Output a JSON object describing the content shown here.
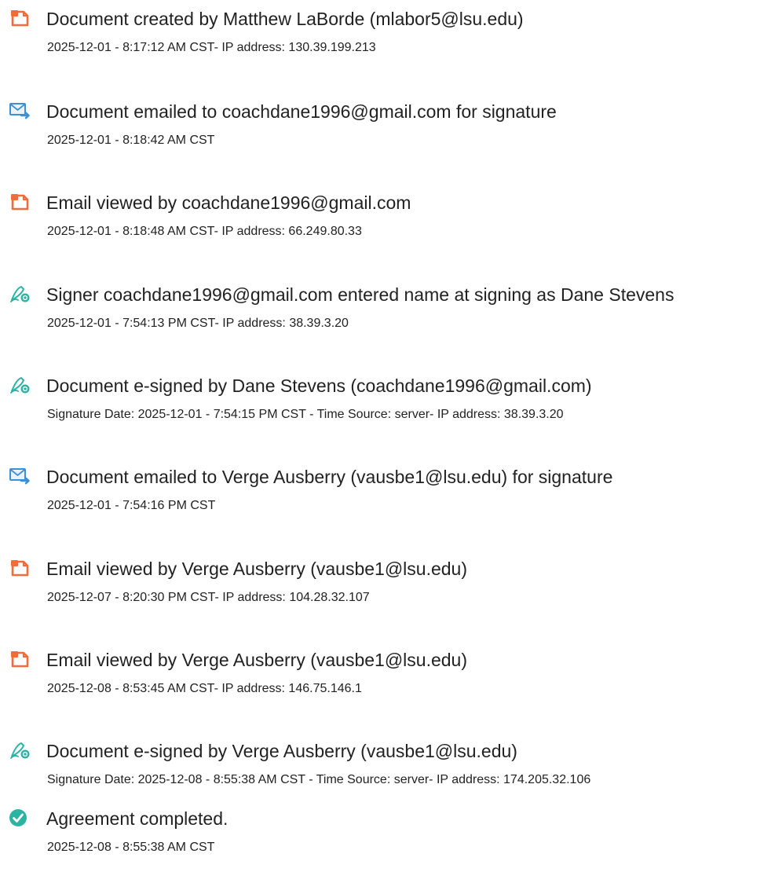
{
  "events": [
    {
      "icon": "document-icon",
      "title": "Document created by Matthew LaBorde (mlabor5@lsu.edu)",
      "detail": "2025-12-01 - 8:17:12 AM CST- IP address: 130.39.199.213"
    },
    {
      "icon": "email-sent-icon",
      "title": "Document emailed to coachdane1996@gmail.com for signature",
      "detail": "2025-12-01 - 8:18:42 AM CST"
    },
    {
      "icon": "document-icon",
      "title": "Email viewed by coachdane1996@gmail.com",
      "detail": "2025-12-01 - 8:18:48 AM CST- IP address: 66.249.80.33"
    },
    {
      "icon": "signature-pen-icon",
      "title": "Signer coachdane1996@gmail.com entered name at signing as Dane Stevens",
      "detail": "2025-12-01 - 7:54:13 PM CST- IP address: 38.39.3.20"
    },
    {
      "icon": "signature-pen-icon",
      "title": "Document e-signed by Dane Stevens (coachdane1996@gmail.com)",
      "detail": "Signature Date: 2025-12-01 - 7:54:15 PM CST - Time Source: server- IP address: 38.39.3.20"
    },
    {
      "icon": "email-sent-icon",
      "title": "Document emailed to Verge Ausberry (vausbe1@lsu.edu) for signature",
      "detail": "2025-12-01 - 7:54:16 PM CST"
    },
    {
      "icon": "document-icon",
      "title": "Email viewed by Verge Ausberry (vausbe1@lsu.edu)",
      "detail": "2025-12-07 - 8:20:30 PM CST- IP address: 104.28.32.107"
    },
    {
      "icon": "document-icon",
      "title": "Email viewed by Verge Ausberry (vausbe1@lsu.edu)",
      "detail": "2025-12-08 - 8:53:45 AM CST- IP address: 146.75.146.1"
    },
    {
      "icon": "signature-pen-icon",
      "title": "Document e-signed by Verge Ausberry (vausbe1@lsu.edu)",
      "detail": "Signature Date: 2025-12-08 - 8:55:38 AM CST - Time Source: server- IP address: 174.205.32.106"
    },
    {
      "icon": "checkmark-circle-icon",
      "title": "Agreement completed.",
      "detail": "2025-12-08 - 8:55:38 AM CST"
    }
  ],
  "colors": {
    "document_icon": "#F26B3A",
    "email_icon": "#3D8FD6",
    "signature_icon": "#2BB3A3",
    "complete_icon": "#2BB3A3",
    "text": "#222222"
  }
}
